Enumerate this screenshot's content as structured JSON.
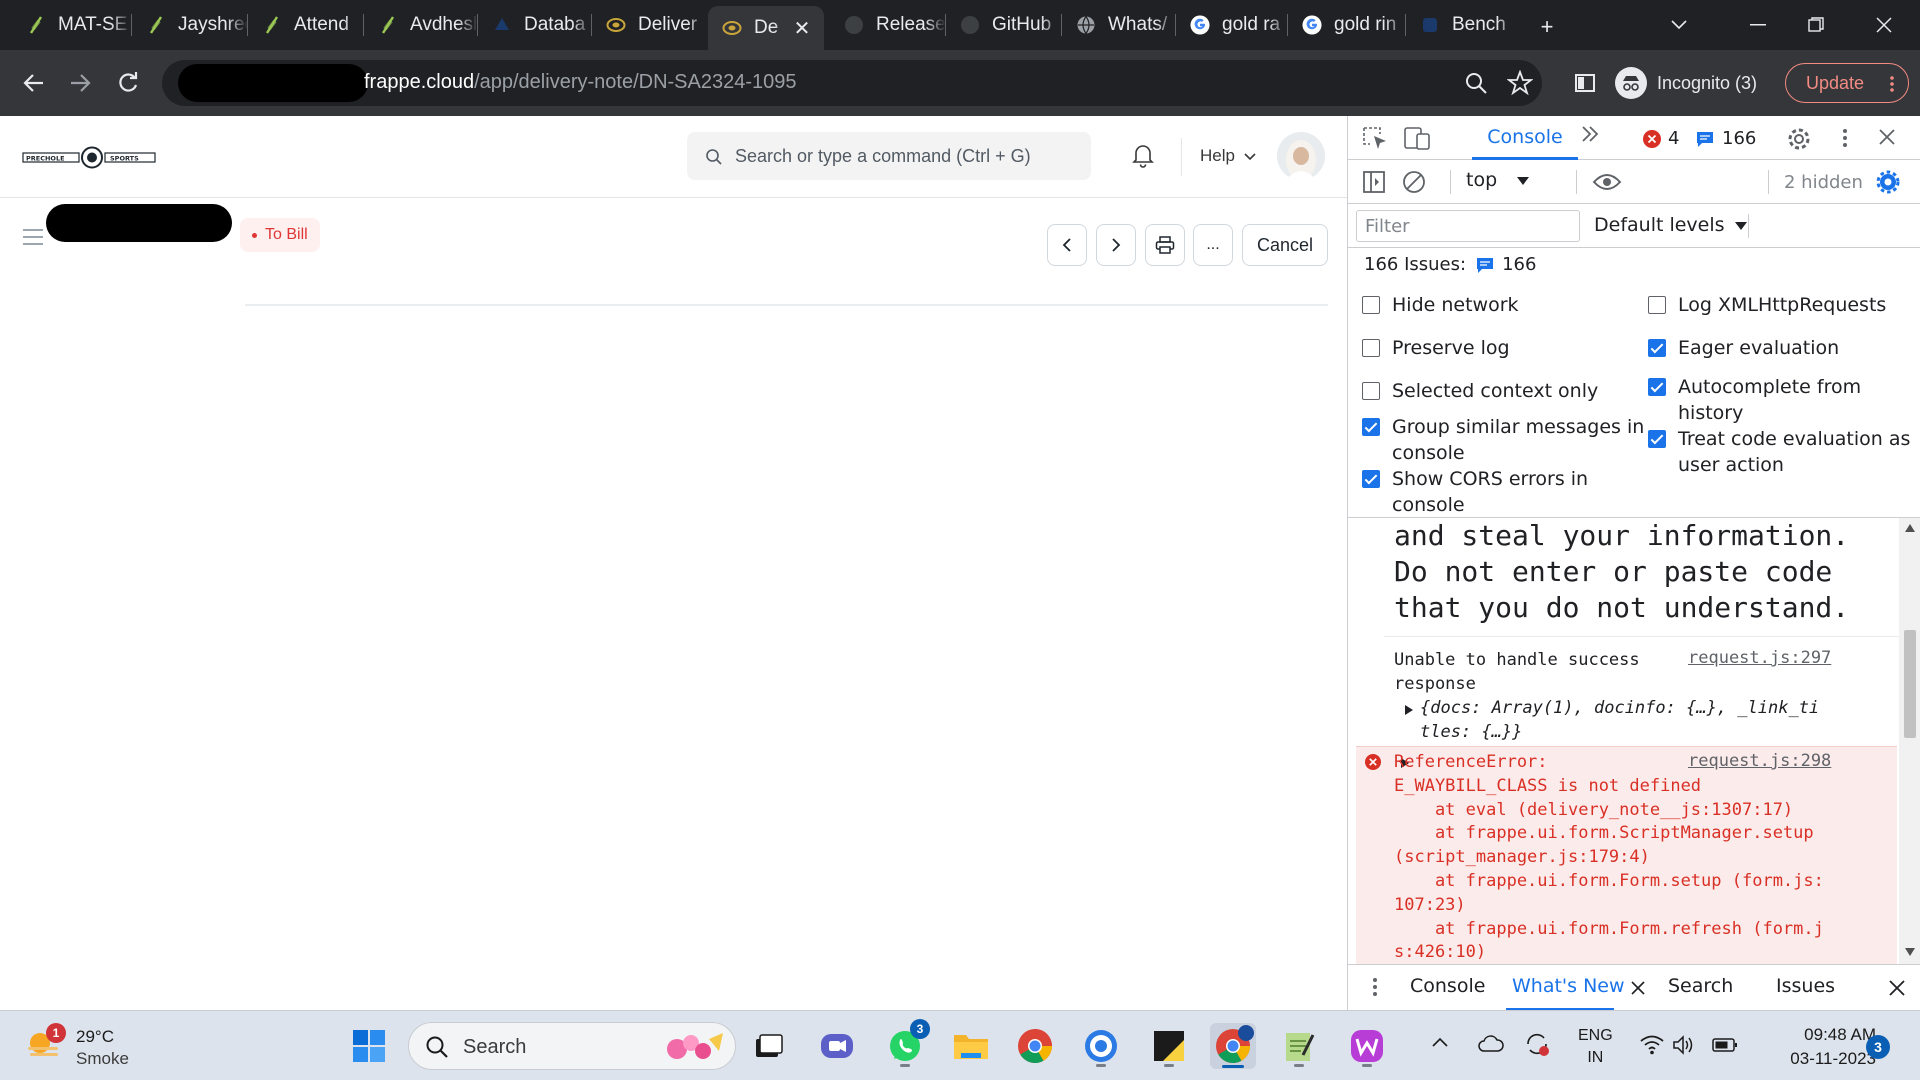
{
  "browser": {
    "tabs": [
      {
        "title": "MAT-SE",
        "icon": "frappe-leaf-icon"
      },
      {
        "title": "Jayshree",
        "icon": "frappe-leaf-icon"
      },
      {
        "title": "Attend",
        "icon": "frappe-leaf-icon"
      },
      {
        "title": "Avdhesh",
        "icon": "frappe-leaf-icon"
      },
      {
        "title": "Databa",
        "icon": "database-icon"
      },
      {
        "title": "Deliver",
        "icon": "frappe-cloud-icon"
      },
      {
        "title": "De",
        "icon": "frappe-cloud-icon",
        "active": true
      },
      {
        "title": "Release",
        "icon": "github-icon"
      },
      {
        "title": "GitHub",
        "icon": "github-icon"
      },
      {
        "title": "Whats/",
        "icon": "globe-icon"
      },
      {
        "title": "gold ra",
        "icon": "google-icon"
      },
      {
        "title": "gold rin",
        "icon": "google-icon"
      },
      {
        "title": "Bench",
        "icon": "bench-icon"
      }
    ],
    "new_tab": "+",
    "url_host": "frappe.cloud",
    "url_path": "/app/delivery-note/DN-SA2324-1095",
    "incognito_label": "Incognito (3)",
    "update_label": "Update"
  },
  "app": {
    "search_placeholder": "Search or type a command (Ctrl + G)",
    "help_label": "Help",
    "status_label": "To Bill",
    "cancel_label": "Cancel",
    "more_label": "...",
    "brand_color": "#e03636"
  },
  "devtools": {
    "tab_console": "Console",
    "error_count": "4",
    "message_count": "166",
    "context": "top",
    "hidden": "2 hidden",
    "filter_placeholder": "Filter",
    "levels": "Default levels",
    "issues_label": "166 Issues:",
    "issues_count": "166",
    "options_left": [
      {
        "label": "Hide network",
        "checked": false
      },
      {
        "label": "Preserve log",
        "checked": false
      },
      {
        "label": "Selected context only",
        "checked": false
      },
      {
        "label": "Group similar messages in\nconsole",
        "checked": true
      },
      {
        "label": "Show CORS errors in\nconsole",
        "checked": true
      }
    ],
    "options_right": [
      {
        "label": "Log XMLHttpRequests",
        "checked": false
      },
      {
        "label": "Eager evaluation",
        "checked": true
      },
      {
        "label": "Autocomplete from\nhistory",
        "checked": true
      },
      {
        "label": "Treat code evaluation as\nuser action",
        "checked": true
      }
    ],
    "warning_text": "and steal your information.\nDo not enter or paste code\nthat you do not understand.",
    "msg1_text": "Unable to handle success\nresponse",
    "msg1_source": "request.js:297",
    "msg1_object": "{docs: Array(1), docinfo: {…}, _link_ti\ntles: {…}}",
    "error_text": "ReferenceError:\nE_WAYBILL_CLASS is not defined\n    at eval (delivery_note__js:1307:17)\n    at frappe.ui.form.ScriptManager.setup\n(script_manager.js:179:4)\n    at frappe.ui.form.Form.setup (form.js:\n107:23)\n    at frappe.ui.form.Form.refresh (form.j\ns:426:10)",
    "error_source": "request.js:298",
    "drawer_tabs": [
      "Console",
      "What's New",
      "Search",
      "Issues"
    ]
  },
  "taskbar": {
    "weather_temp": "29°C",
    "weather_desc": "Smoke",
    "weather_badge": "1",
    "search_label": "Search",
    "whatsapp_badge": "3",
    "lang_top": "ENG",
    "lang_bottom": "IN",
    "time": "09:48 AM",
    "date": "03-11-2023",
    "notif_badge": "3"
  }
}
